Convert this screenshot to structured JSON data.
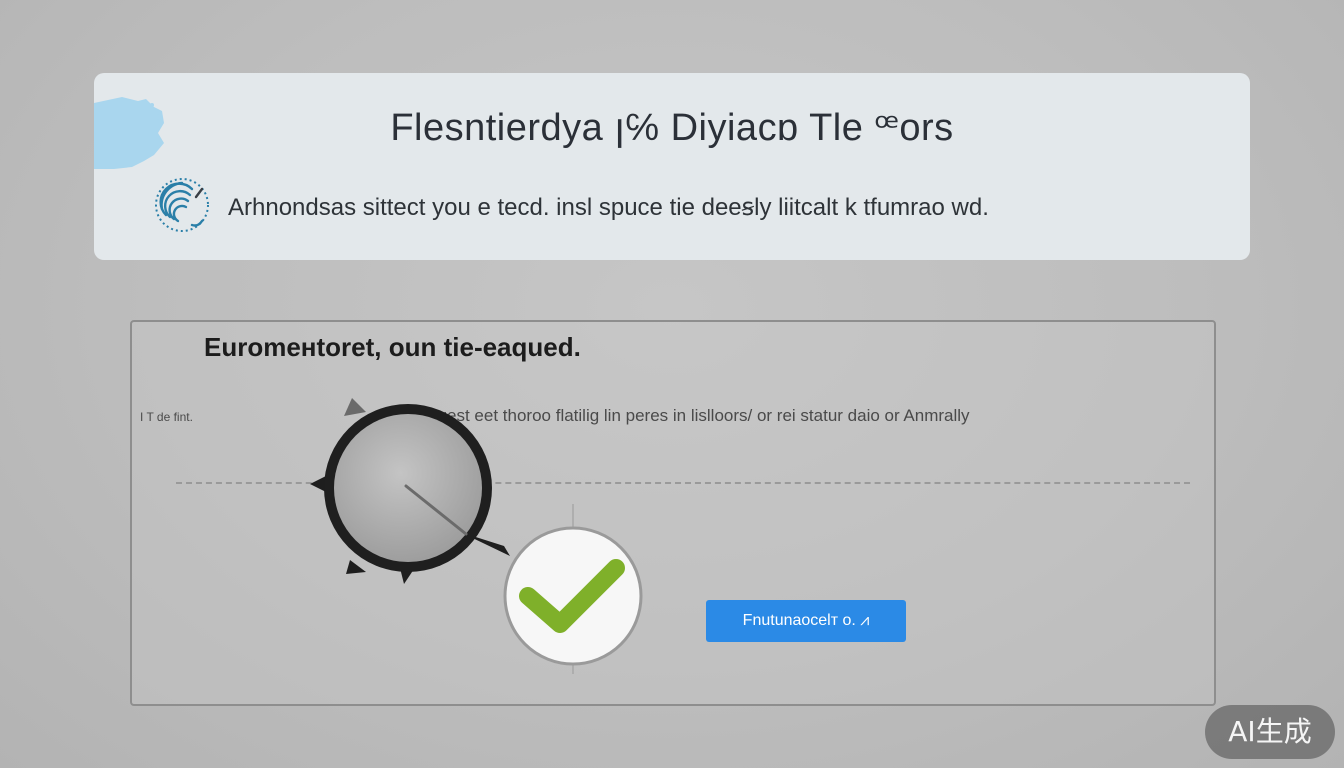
{
  "header": {
    "title": "Flesntierdya ꞁ℅ Diyiacɒ Tle ꟹors",
    "subtitle": "Arhnondsas sittect you e tecd. insl spuce tie deeꞩly liitcalt k tfumrao wd.",
    "icon": "fingerprint-icon"
  },
  "panel": {
    "heading": "Euromeнtoret, oun tie-eaqued.",
    "row_label": "I T de fint.",
    "row_description": "tcnet gest eet thoroo flatilig lin peres in lislloors/ or rei statur daio or Anmrally",
    "gauge_icon": "gauge-dial-icon",
    "check_icon": "checkmark-icon",
    "button_label": "Fnutunaocelт o. ⩘"
  },
  "colors": {
    "accent": "#2b8ae6",
    "check": "#7fb02a",
    "header_bg": "#e3e8eb",
    "splash": "#a9d6ee"
  },
  "watermark": "AI生成"
}
